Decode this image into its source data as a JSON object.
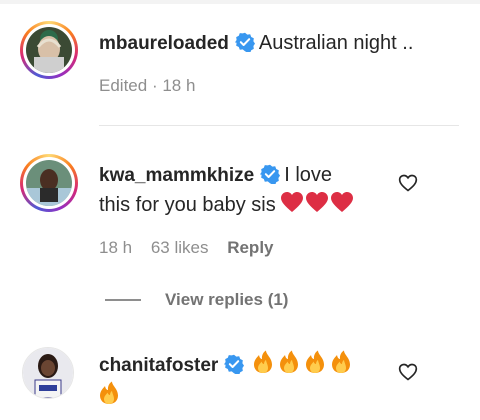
{
  "comments": [
    {
      "username": "mbaureloaded",
      "text": "Australian night ..",
      "edited_label": "Edited",
      "separator": "·",
      "time": "18 h"
    },
    {
      "username": "kwa_mammkhize",
      "text_line1": "I love",
      "text_line2": "this for you baby sis",
      "time": "18 h",
      "likes": "63 likes",
      "reply_label": "Reply",
      "view_replies": "View replies (1)"
    },
    {
      "username": "chanitafoster"
    }
  ],
  "colors": {
    "verified_badge": "#3897f0",
    "text_primary": "#262626",
    "text_secondary": "#8e8e8e"
  },
  "icons": [
    "verified-badge-icon",
    "heart-outline-icon",
    "red-heart-emoji",
    "fire-emoji"
  ]
}
